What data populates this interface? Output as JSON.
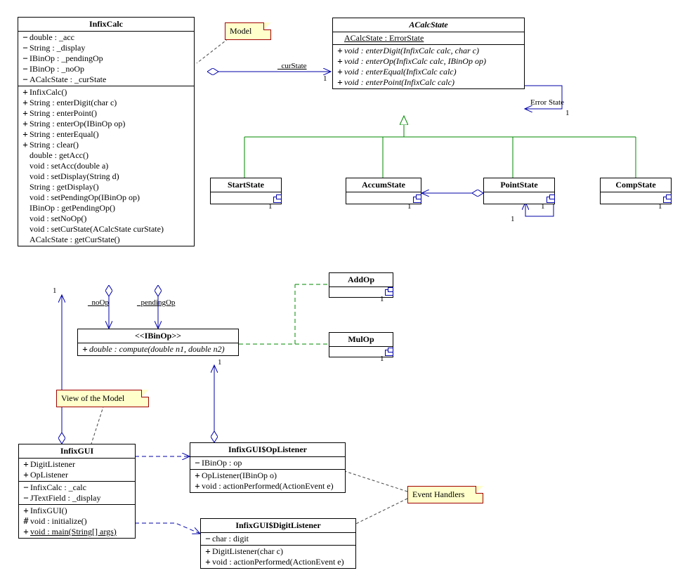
{
  "notes": {
    "model": "Model",
    "view": "View of the Model",
    "handlers": "Event Handlers"
  },
  "labels": {
    "curState": "_curState",
    "noOp": "_noOp",
    "pendingOp": "_pendingOp",
    "errorState": "Error State",
    "one": "1"
  },
  "classes": {
    "InfixCalc": {
      "name": "InfixCalc",
      "attrs": [
        {
          "v": "−",
          "t": "double : _acc"
        },
        {
          "v": "−",
          "t": "String : _display"
        },
        {
          "v": "−",
          "t": "IBinOp : _pendingOp"
        },
        {
          "v": "−",
          "t": "IBinOp : _noOp"
        },
        {
          "v": "−",
          "t": "ACalcState : _curState"
        }
      ],
      "ops": [
        {
          "v": "+",
          "t": "InfixCalc()"
        },
        {
          "v": "+",
          "t": "String : enterDigit(char c)"
        },
        {
          "v": "+",
          "t": "String : enterPoint()"
        },
        {
          "v": "+",
          "t": "String : enterOp(IBinOp op)"
        },
        {
          "v": "+",
          "t": "String : enterEqual()"
        },
        {
          "v": "+",
          "t": "String : clear()"
        },
        {
          "v": "",
          "t": "double : getAcc()"
        },
        {
          "v": "",
          "t": "void : setAcc(double a)"
        },
        {
          "v": "",
          "t": "void : setDisplay(String d)"
        },
        {
          "v": "",
          "t": "String : getDisplay()"
        },
        {
          "v": "",
          "t": "void : setPendingOp(IBinOp op)"
        },
        {
          "v": "",
          "t": "IBinOp : getPendingOp()"
        },
        {
          "v": "",
          "t": "void : setNoOp()"
        },
        {
          "v": "",
          "t": "void : setCurState(ACalcState curState)"
        },
        {
          "v": "",
          "t": "ACalcState : getCurState()"
        }
      ]
    },
    "ACalcState": {
      "name": "ACalcState",
      "attrs": [
        {
          "v": "",
          "t": "ACalcState : ErrorState",
          "u": true
        }
      ],
      "ops": [
        {
          "v": "+",
          "t": "void : enterDigit(InfixCalc calc, char c)",
          "i": true
        },
        {
          "v": "+",
          "t": "void : enterOp(InfixCalc calc, IBinOp op)",
          "i": true
        },
        {
          "v": "+",
          "t": "void : enterEqual(InfixCalc calc)",
          "i": true
        },
        {
          "v": "+",
          "t": "void : enterPoint(InfixCalc calc)",
          "i": true
        }
      ]
    },
    "StartState": {
      "name": "StartState"
    },
    "AccumState": {
      "name": "AccumState"
    },
    "PointState": {
      "name": "PointState"
    },
    "CompState": {
      "name": "CompState"
    },
    "IBinOp": {
      "stereo": "<<IBinOp>>",
      "ops": [
        {
          "v": "+",
          "t": "double : compute(double n1, double n2)",
          "i": true
        }
      ]
    },
    "AddOp": {
      "name": "AddOp"
    },
    "MulOp": {
      "name": "MulOp"
    },
    "InfixGUI": {
      "name": "InfixGUI",
      "nested": [
        {
          "v": "+",
          "t": "DigitListener"
        },
        {
          "v": "+",
          "t": "OpListener"
        }
      ],
      "attrs": [
        {
          "v": "−",
          "t": "InfixCalc : _calc"
        },
        {
          "v": "−",
          "t": "JTextField : _display"
        }
      ],
      "ops": [
        {
          "v": "+",
          "t": "InfixGUI()"
        },
        {
          "v": "#",
          "t": "void : initialize()"
        },
        {
          "v": "+",
          "t": "void : main(String[] args)",
          "u": true
        }
      ]
    },
    "OpListener": {
      "name": "InfixGUI$OpListener",
      "attrs": [
        {
          "v": "−",
          "t": "IBinOp : op"
        }
      ],
      "ops": [
        {
          "v": "+",
          "t": "OpListener(IBinOp o)"
        },
        {
          "v": "+",
          "t": "void : actionPerformed(ActionEvent e)"
        }
      ]
    },
    "DigitListener": {
      "name": "InfixGUI$DigitListener",
      "attrs": [
        {
          "v": "−",
          "t": "char : digit"
        }
      ],
      "ops": [
        {
          "v": "+",
          "t": "DigitListener(char c)"
        },
        {
          "v": "+",
          "t": "void : actionPerformed(ActionEvent e)"
        }
      ]
    }
  }
}
